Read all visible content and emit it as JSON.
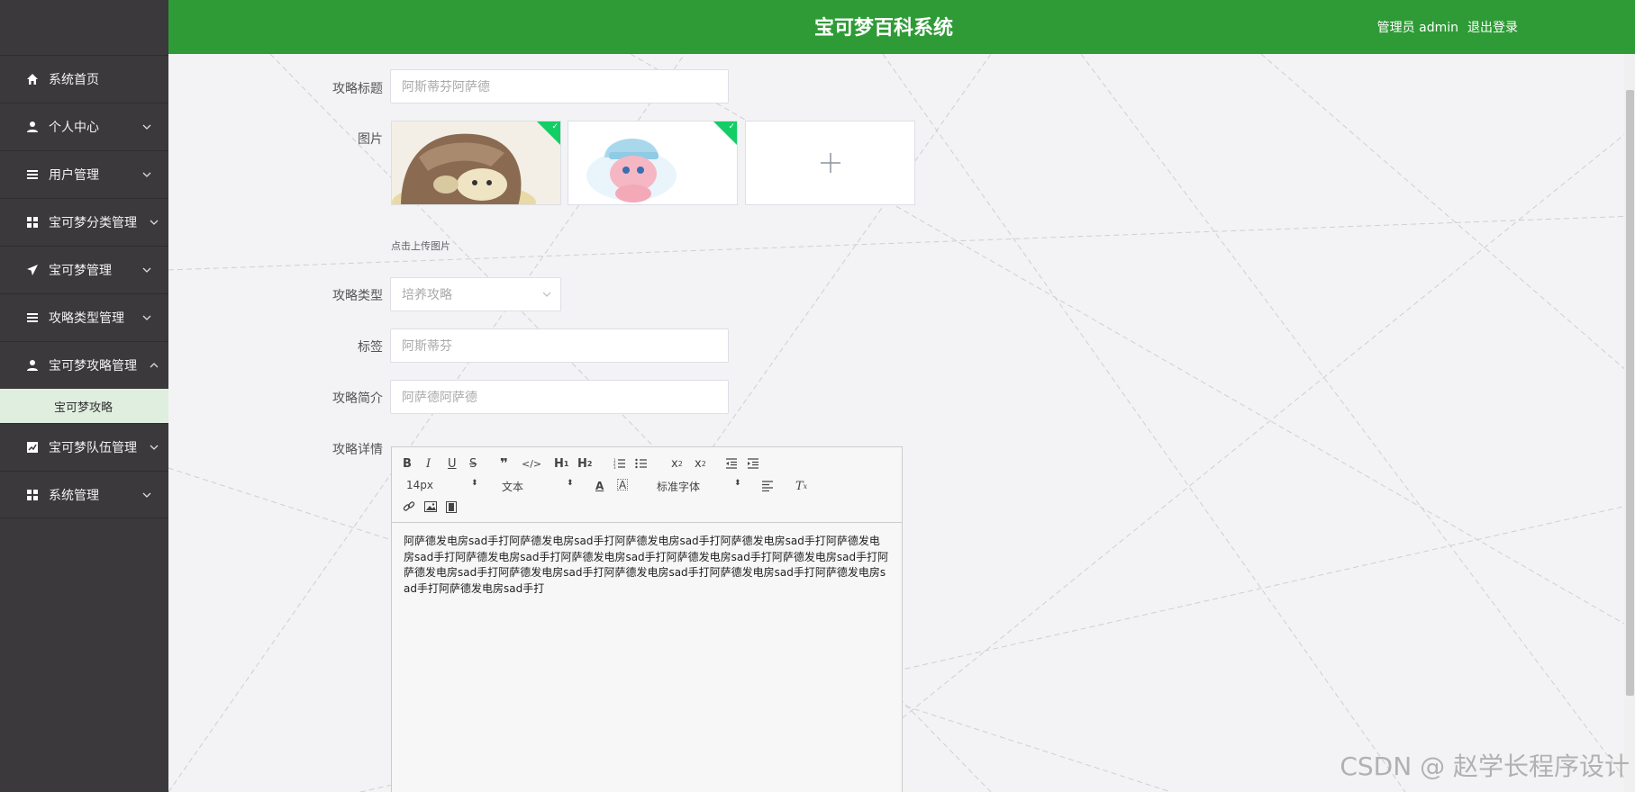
{
  "header": {
    "title": "宝可梦百科系统",
    "user_label": "管理员 admin",
    "logout_label": "退出登录"
  },
  "sidebar": {
    "items": [
      {
        "label": "系统首页",
        "icon": "home-icon"
      },
      {
        "label": "个人中心",
        "icon": "user-icon"
      },
      {
        "label": "用户管理",
        "icon": "list-icon"
      },
      {
        "label": "宝可梦分类管理",
        "icon": "grid-icon"
      },
      {
        "label": "宝可梦管理",
        "icon": "send-icon"
      },
      {
        "label": "攻略类型管理",
        "icon": "list-icon"
      },
      {
        "label": "宝可梦攻略管理",
        "icon": "user-icon"
      },
      {
        "label": "宝可梦队伍管理",
        "icon": "chart-icon"
      },
      {
        "label": "系统管理",
        "icon": "grid-icon"
      }
    ],
    "active_submenu": "宝可梦攻略"
  },
  "form": {
    "title_label": "攻略标题",
    "title_value": "阿斯蒂芬阿萨德",
    "image_label": "图片",
    "upload_hint": "点击上传图片",
    "type_label": "攻略类型",
    "type_value": "培养攻略",
    "tag_label": "标签",
    "tag_value": "阿斯蒂芬",
    "intro_label": "攻略简介",
    "intro_value": "阿萨德阿萨德",
    "detail_label": "攻略详情"
  },
  "editor": {
    "font_size": "14px",
    "block_format": "文本",
    "font_family": "标准字体",
    "content": "阿萨德发电房sad手打阿萨德发电房sad手打阿萨德发电房sad手打阿萨德发电房sad手打阿萨德发电房sad手打阿萨德发电房sad手打阿萨德发电房sad手打阿萨德发电房sad手打阿萨德发电房sad手打阿萨德发电房sad手打阿萨德发电房sad手打阿萨德发电房sad手打阿萨德发电房sad手打阿萨德发电房sad手打阿萨德发电房sad手打"
  },
  "watermark": "CSDN @ 赵学长程序设计",
  "colors": {
    "header_green": "#2f9b36",
    "sidebar_bg": "#3b393c",
    "submenu_active_bg": "#dfeedf",
    "upload_corner": "#13ce66"
  }
}
